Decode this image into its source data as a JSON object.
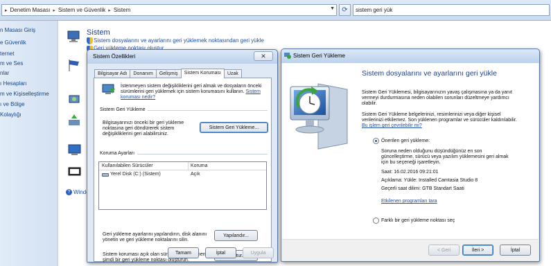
{
  "explorer": {
    "breadcrumb": [
      "Denetim Masası",
      "Sistem ve Güvenlik",
      "Sistem"
    ],
    "search_value": "sistem geri yük",
    "left_nav": [
      "n Masası Giriş",
      "e Güvenlik",
      "ternet",
      "m ve Ses",
      "nlar",
      "ı Hesapları",
      "m ve Kişiselleştirme",
      "ı ve Bölge",
      "Kolaylığı"
    ],
    "main_title": "Sistem",
    "main_link_1": "Sistem dosyalarını ve ayarlarını geri yüklemek noktasından geri yükle",
    "main_link_2": "Geri yükleme noktası oluştur",
    "windows_help_fragment": "Windo"
  },
  "sysprops": {
    "title": "Sistem Özellikleri",
    "close_label": "✕",
    "tabs": [
      "Bilgisayar Adı",
      "Donanım",
      "Gelişmiş",
      "Sistem Koruması",
      "Uzak"
    ],
    "intro_line_1": "İstenmeyen sistem değişikliklerini geri almak ve dosyaların önceki",
    "intro_line_2": "sürümlerini geri yüklemek için sistem korumasını kullanın.",
    "intro_link_part1": "Sistem",
    "intro_link_part2": "koruması nedir?",
    "restore_group_title": "Sistem Geri Yükleme",
    "restore_text_1": "Bilgisayarınızı önceki bir geri yükleme",
    "restore_text_2": "noktasına geri döndürerek sistem",
    "restore_text_3": "değişikliklerini geri alabilirsiniz.",
    "restore_button": "Sistem Geri Yükleme...",
    "protection_group_title": "Koruma Ayarları",
    "table_header_drive": "Kullanılabilen Sürücüler",
    "table_header_protection": "Koruma",
    "drive_name": "Yerel Disk (C:) (Sistem)",
    "drive_protection": "Açık",
    "configure_text_1": "Geri yükleme ayarlarını yapılandırın, disk alanını",
    "configure_text_2": "yönetin ve geri yükleme noktalarını silin.",
    "configure_button": "Yapılandır...",
    "create_text_1": "Sistem koruması açık olan sürücüler için hemen",
    "create_text_2": "şimdi bir geri yükleme noktası oluşturun.",
    "create_button": "Oluştur...",
    "ok_button": "Tamam",
    "cancel_button": "İptal",
    "apply_button": "Uygula"
  },
  "wizard": {
    "title": "Sistem Geri Yükleme",
    "heading": "Sistem dosyalarını ve ayarlarını geri yükle",
    "para1": [
      "Sistem Geri Yüklemesi, bilgisayarınızın yavaş çalışmasına ya da yanıt",
      "vermeyi durdurmasına neden olabilen sorunları düzeltmeye yardımcı",
      "olabilir."
    ],
    "para2": [
      "Sistem Geri Yükleme belgelerinizi, resimlerinizi veya diğer kişisel",
      "verilerinizi etkilemez. Son yüklenen programlar ve sürücüler kaldırılabilir."
    ],
    "how_link": "Bu işlem geri çevrilebilir mi?",
    "recommended_label": "Önerilen geri yükleme:",
    "recommended_desc": [
      "Soruna neden olduğunu düşündüğünüz en son",
      "güncelleştirme, sürücü veya yazılım yüklemesini geri almak",
      "için bu seçeneği işaretleyin."
    ],
    "time_line": "Saat: 16.02.2016 09:21:01",
    "desc_line": "Açıklama: Yükle: Installed Camtasia Studio 8",
    "tz_line": "Geçerli saat dilimi: GTB Standart Saati",
    "affected_link": "Etkilenen programları tara",
    "other_label": "Farklı bir geri yükleme noktası seç",
    "back_button": "< Geri",
    "next_button": "İleri >",
    "cancel_button": "İptal"
  }
}
